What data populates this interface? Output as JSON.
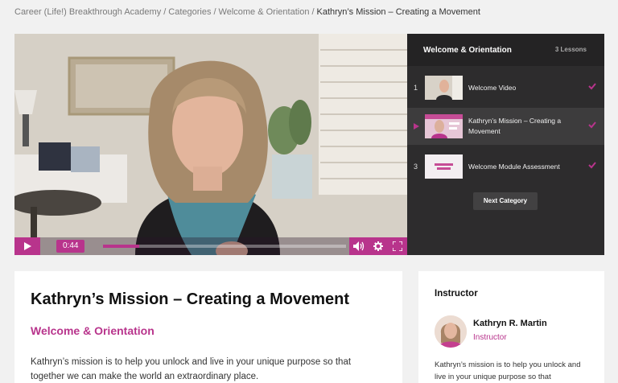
{
  "breadcrumb": {
    "items": [
      "Career (Life!) Breakthrough Academy",
      "Categories",
      "Welcome & Orientation"
    ],
    "separator": "/",
    "current": "Kathryn’s Mission – Creating a Movement"
  },
  "video": {
    "time": "0:44",
    "progress_fraction": 0.15,
    "icons": [
      "play-icon",
      "volume-icon",
      "settings-icon",
      "fullscreen-icon"
    ]
  },
  "lessons_panel": {
    "title": "Welcome & Orientation",
    "count": "3 Lessons",
    "lessons": [
      {
        "num": "1",
        "title": "Welcome Video",
        "completed": true,
        "active": false
      },
      {
        "num": "",
        "title": "Kathryn’s Mission – Creating a Movement",
        "completed": true,
        "active": true
      },
      {
        "num": "3",
        "title": "Welcome Module Assessment",
        "completed": true,
        "active": false
      }
    ],
    "next_label": "Next Category"
  },
  "main": {
    "title": "Kathryn’s Mission – Creating a Movement",
    "category": "Welcome & Orientation",
    "description": "Kathryn’s mission is to help you unlock and live in your unique purpose so that together we can make the world an extraordinary place."
  },
  "instructor": {
    "heading": "Instructor",
    "name": "Kathryn R. Martin",
    "role": "Instructor",
    "description": "Kathryn’s mission is to help you unlock and live in your unique purpose so that"
  },
  "colors": {
    "accent": "#b8348c",
    "panel_bg": "#2d2c2d",
    "page_bg": "#f1f1f1"
  }
}
